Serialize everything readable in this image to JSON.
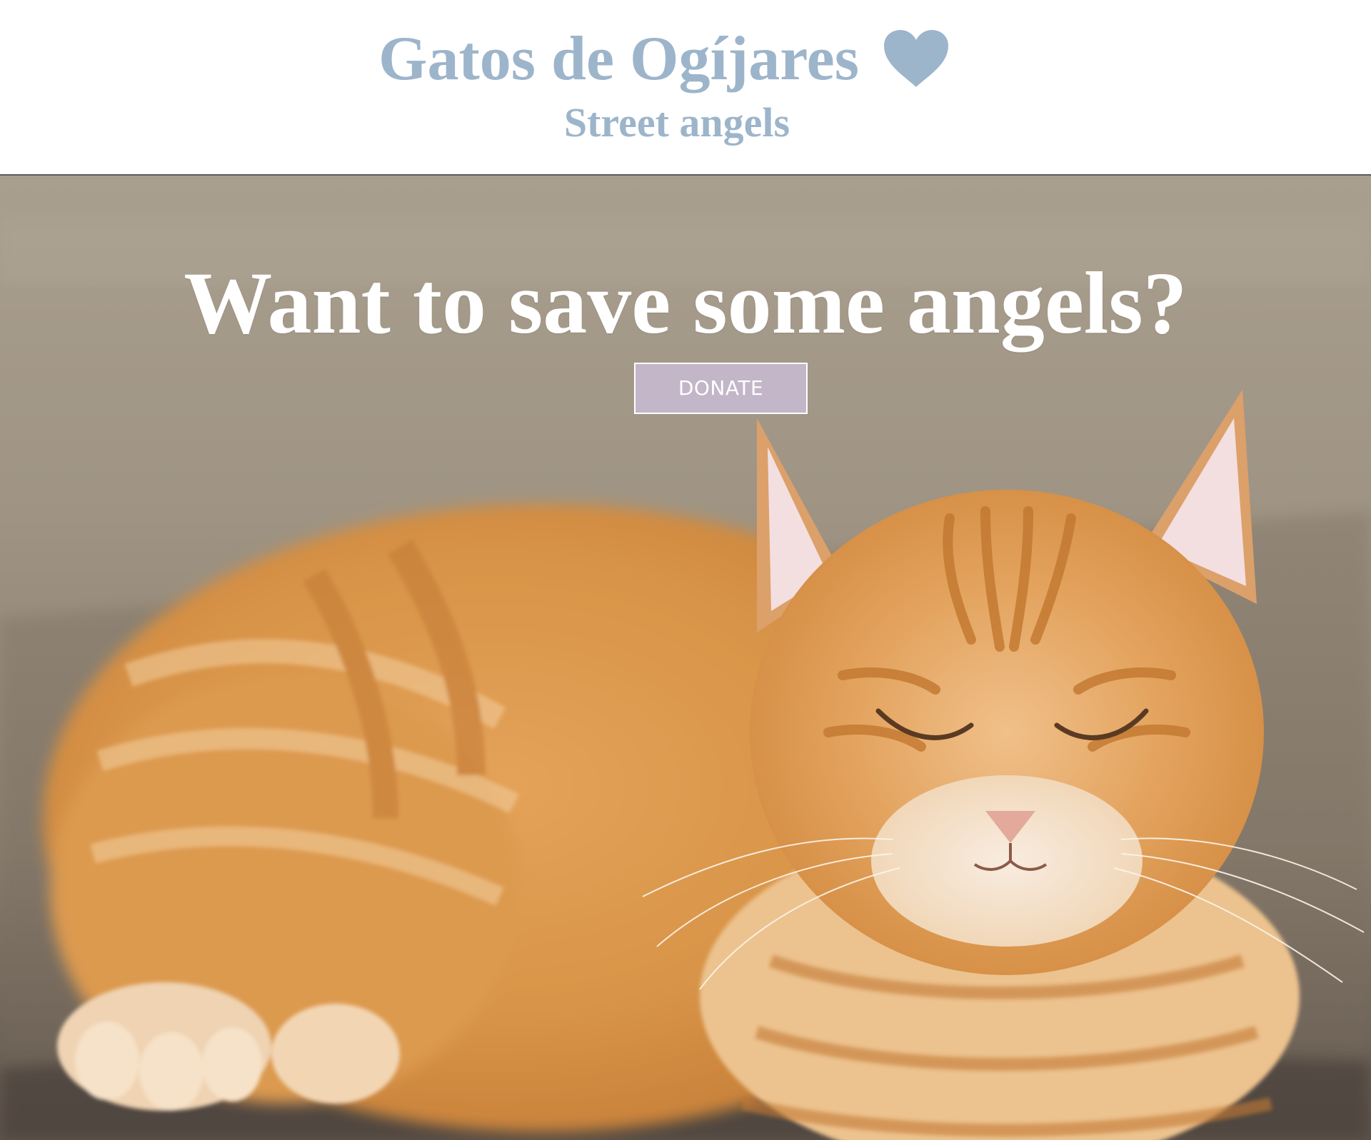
{
  "header": {
    "title": "Gatos de Ogíjares",
    "title_icon": "heart-icon",
    "subtitle": "Street angels"
  },
  "hero": {
    "heading": "Want to save some angels?",
    "donate_label": "DONATE",
    "image": "orange-tabby-cat-photo"
  },
  "colors": {
    "brand": "#9db5cb",
    "button_bg": "#c2b6c8",
    "hero_text": "#ffffff"
  }
}
